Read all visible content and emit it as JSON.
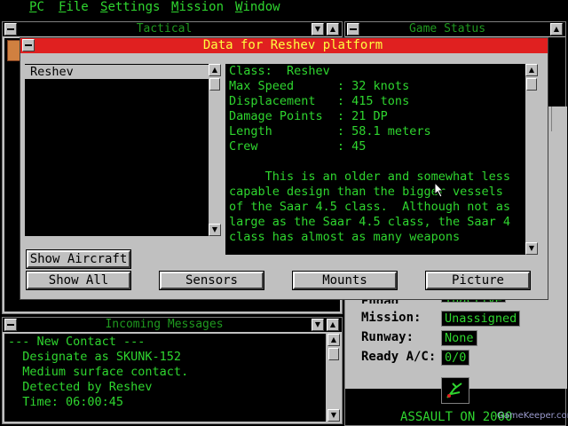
{
  "menubar": {
    "items": [
      {
        "label": "PC",
        "key": "P"
      },
      {
        "label": "File",
        "key": "F"
      },
      {
        "label": "Settings",
        "key": "S"
      },
      {
        "label": "Mission",
        "key": "M"
      },
      {
        "label": "Window",
        "key": "W"
      }
    ]
  },
  "tactical": {
    "title": "Tactical"
  },
  "game_status": {
    "title": "Game Status",
    "fields": [
      {
        "label": "Mission:",
        "value": "Unassigned"
      },
      {
        "label": "Runway:",
        "value": "None"
      },
      {
        "label": "Ready A/C:",
        "value": "0/0"
      }
    ],
    "partial_label": "Engag",
    "partial_value": "Inactive",
    "footer": "ASSAULT ON 2000"
  },
  "data_dialog": {
    "title": "Data for Reshev platform",
    "platforms": [
      "Reshev"
    ],
    "selected_platform": "Reshev",
    "specs": [
      "Class:  Reshev",
      "Max Speed      : 32 knots",
      "Displacement   : 415 tons",
      "Damage Points  : 21 DP",
      "Length         : 58.1 meters",
      "Crew           : 45"
    ],
    "description": [
      "     This is an older and somewhat less",
      "capable design than the bigger vessels",
      "of the Saar 4.5 class.  Although not as",
      "large as the Saar 4.5 class, the Saar 4",
      "class has almost as many weapons"
    ],
    "buttons": {
      "show_aircraft": "Show Aircraft",
      "show_all": "Show All",
      "sensors": "Sensors",
      "mounts": "Mounts",
      "picture": "Picture"
    }
  },
  "messages": {
    "title": "Incoming Messages",
    "lines": [
      "--- New Contact ---",
      "  Designate as SKUNK-152",
      "  Medium surface contact.",
      "  Detected by Reshev",
      "  Time: 06:00:45"
    ]
  },
  "watermark": "GameKeeper.com",
  "colors": {
    "title_active": "#e02020",
    "title_text": "#ffff40",
    "console_green": "#2fd62f",
    "chrome": "#c0c0c0"
  }
}
